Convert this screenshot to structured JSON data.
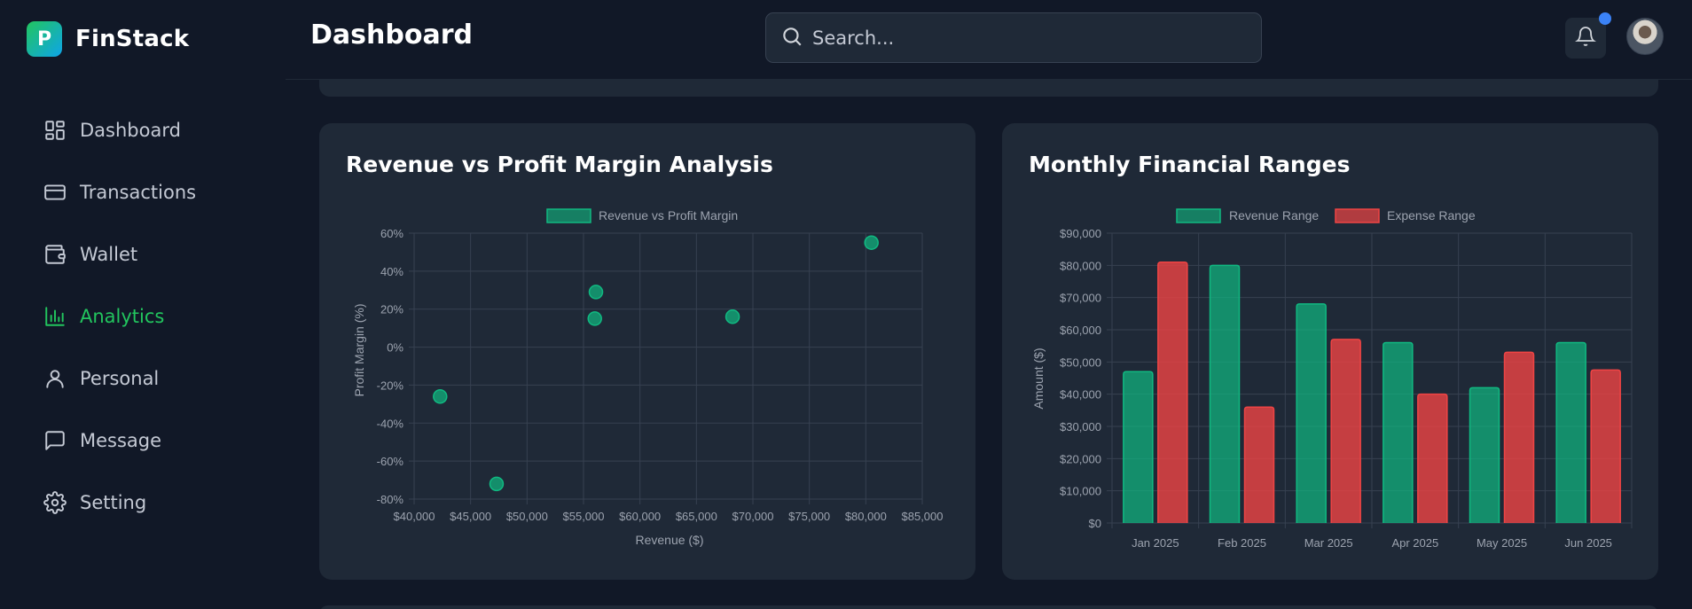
{
  "brand": {
    "logo_letter": "P",
    "name": "FinStack"
  },
  "nav": [
    {
      "label": "Dashboard",
      "icon": "dashboard-icon",
      "active": false
    },
    {
      "label": "Transactions",
      "icon": "card-icon",
      "active": false
    },
    {
      "label": "Wallet",
      "icon": "wallet-icon",
      "active": false
    },
    {
      "label": "Analytics",
      "icon": "bar-chart-icon",
      "active": true
    },
    {
      "label": "Personal",
      "icon": "user-icon",
      "active": false
    },
    {
      "label": "Message",
      "icon": "message-icon",
      "active": false
    },
    {
      "label": "Setting",
      "icon": "gear-icon",
      "active": false
    }
  ],
  "header": {
    "title": "Dashboard",
    "search_placeholder": "Search..."
  },
  "colors": {
    "accent": "#22c55e",
    "revenue": "#10b981",
    "expense": "#ef4444",
    "notification_dot": "#3b82f6"
  },
  "chart_data": [
    {
      "type": "scatter",
      "card_title": "Revenue vs Profit Margin Analysis",
      "xlabel": "Revenue ($)",
      "ylabel": "Profit Margin (%)",
      "xlim": [
        40000,
        85000
      ],
      "ylim": [
        -80,
        60
      ],
      "x_ticks": [
        "$40,000",
        "$45,000",
        "$50,000",
        "$55,000",
        "$60,000",
        "$65,000",
        "$70,000",
        "$75,000",
        "$80,000",
        "$85,000"
      ],
      "y_ticks": [
        "60%",
        "40%",
        "20%",
        "0%",
        "-20%",
        "-40%",
        "-60%",
        "-80%"
      ],
      "grid": true,
      "legend_position": "top",
      "series": [
        {
          "name": "Revenue vs Profit Margin",
          "color": "#10b981",
          "points": [
            {
              "x": 42300,
              "y": -26
            },
            {
              "x": 47300,
              "y": -72
            },
            {
              "x": 56100,
              "y": 29
            },
            {
              "x": 56000,
              "y": 15
            },
            {
              "x": 68200,
              "y": 16
            },
            {
              "x": 80500,
              "y": 55
            }
          ]
        }
      ]
    },
    {
      "type": "bar",
      "card_title": "Monthly Financial Ranges",
      "xlabel": "",
      "ylabel": "Amount ($)",
      "ylim": [
        0,
        90000
      ],
      "y_ticks": [
        "$90,000",
        "$80,000",
        "$70,000",
        "$60,000",
        "$50,000",
        "$40,000",
        "$30,000",
        "$20,000",
        "$10,000",
        "$0"
      ],
      "categories": [
        "Jan 2025",
        "Feb 2025",
        "Mar 2025",
        "Apr 2025",
        "May 2025",
        "Jun 2025"
      ],
      "grid": true,
      "legend_position": "top",
      "series": [
        {
          "name": "Revenue Range",
          "color": "#10b981",
          "values": [
            47000,
            80000,
            68000,
            56000,
            42000,
            56000
          ]
        },
        {
          "name": "Expense Range",
          "color": "#ef4444",
          "values": [
            81000,
            36000,
            57000,
            40000,
            53000,
            47500
          ]
        }
      ]
    }
  ]
}
